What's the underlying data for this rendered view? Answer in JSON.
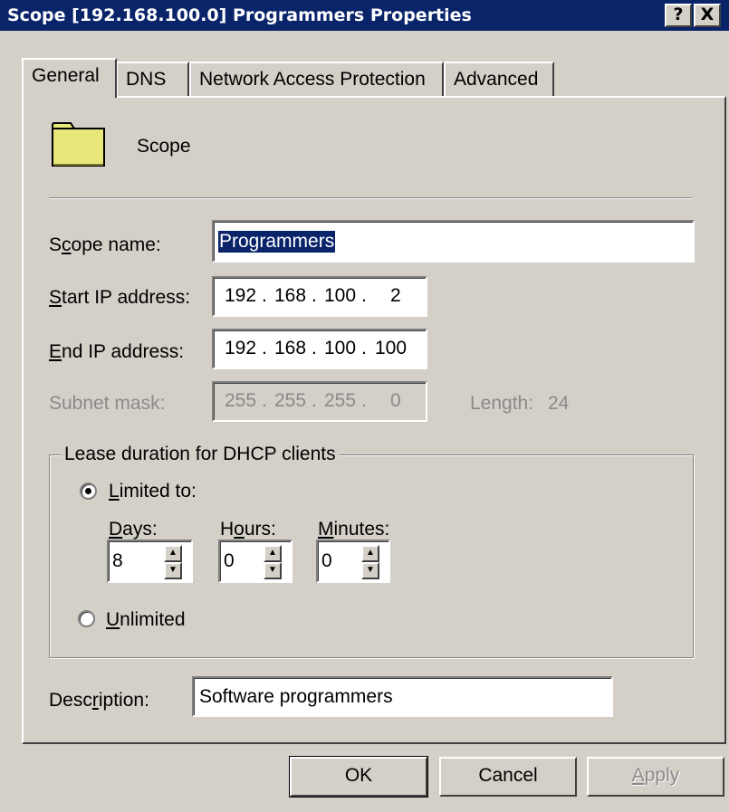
{
  "window": {
    "title": "Scope [192.168.100.0] Programmers Properties",
    "help_button": "?",
    "close_button": "X"
  },
  "tabs": [
    {
      "label": "General",
      "active": true
    },
    {
      "label": "DNS",
      "active": false
    },
    {
      "label": "Network Access Protection",
      "active": false
    },
    {
      "label": "Advanced",
      "active": false
    }
  ],
  "header": {
    "icon": "folder-icon",
    "label": "Scope"
  },
  "form": {
    "scope_name": {
      "label_pre": "S",
      "label_u": "c",
      "label_post": "ope name:",
      "value": "Programmers"
    },
    "start_ip": {
      "label_u": "S",
      "label_post": "tart IP address:",
      "octets": [
        "192",
        "168",
        "100",
        "2"
      ]
    },
    "end_ip": {
      "label_u": "E",
      "label_post": "nd IP address:",
      "octets": [
        "192",
        "168",
        "100",
        "100"
      ]
    },
    "subnet_mask": {
      "label": "Subnet mask:",
      "octets": [
        "255",
        "255",
        "255",
        "0"
      ],
      "length_label": "Length:",
      "length_value": "24"
    }
  },
  "lease": {
    "group_title": "Lease duration for DHCP clients",
    "limited": {
      "label_u": "L",
      "label_post": "imited to:",
      "selected": true
    },
    "days": {
      "label_u": "D",
      "label_post": "ays:",
      "value": "8"
    },
    "hours": {
      "label_pre": "H",
      "label_u": "o",
      "label_post": "urs:",
      "value": "0"
    },
    "minutes": {
      "label_u": "M",
      "label_post": "inutes:",
      "value": "0"
    },
    "unlimited": {
      "label_u": "U",
      "label_post": "nlimited",
      "selected": false
    }
  },
  "description": {
    "label_pre": "Desc",
    "label_u": "r",
    "label_post": "iption:",
    "value": "Software programmers"
  },
  "buttons": {
    "ok": "OK",
    "cancel": "Cancel",
    "apply_u": "A",
    "apply_post": "pply"
  },
  "colors": {
    "titlebar": "#0a246a",
    "face": "#d4d0c8",
    "selection": "#0a246a",
    "folder": "#e8e87a"
  }
}
